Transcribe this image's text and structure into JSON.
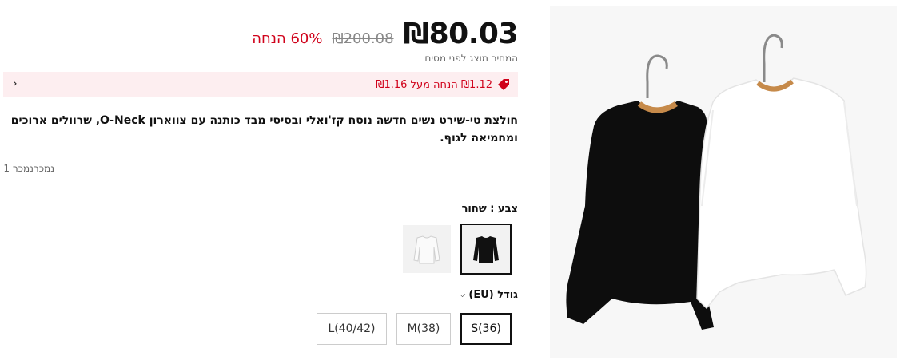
{
  "price": {
    "current": "₪80.03",
    "original": "₪200.08",
    "discount": "60% הנחה",
    "tax_note": "המחיר מוצג לפני מסים"
  },
  "promo": {
    "text": "₪1.12 הנחה מעל ₪1.16",
    "icon": "tag-icon",
    "chevron": "‹"
  },
  "product": {
    "title": "חולצת טי-שירט נשים חדשה נוסח קז'ואלי ובסיסי מבד כותנה עם צווארון O-Neck, שרוולים ארוכים ומחמיאה לגוף.",
    "sold": "נמכרנמכר 1"
  },
  "color": {
    "label": "צבע : שחור",
    "options": [
      "שחור",
      "לבן"
    ],
    "selected": "שחור"
  },
  "size": {
    "label": "גודל (EU)",
    "options": [
      "S(36)",
      "M(38)",
      "L(40/42)"
    ],
    "selected": "S(36)"
  },
  "colors": {
    "accent": "#d0021b",
    "promo_bg": "#fdeef0"
  }
}
